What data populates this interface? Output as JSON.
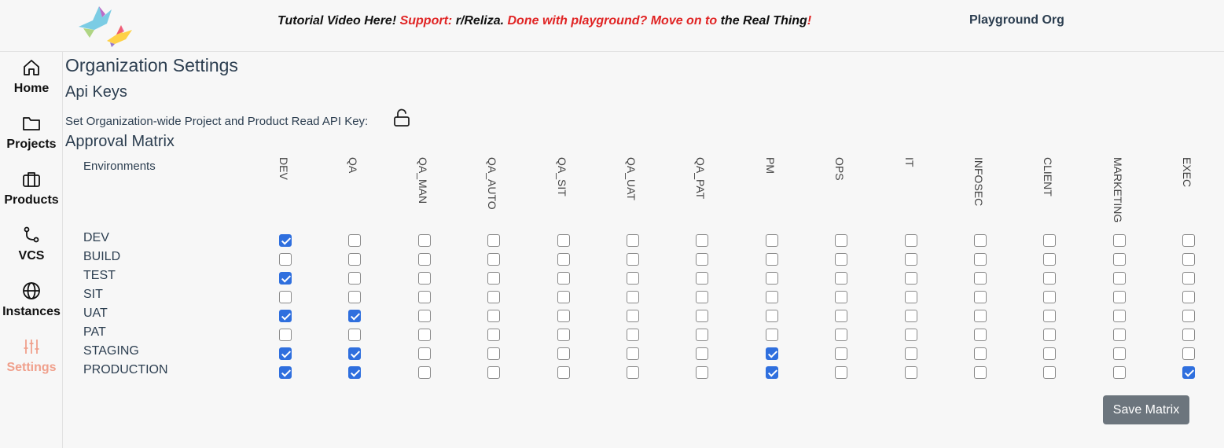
{
  "header": {
    "banner": [
      {
        "text": "Tutorial Video Here!",
        "style": "black"
      },
      {
        "text": " Support: ",
        "style": "red"
      },
      {
        "text": "r/Reliza",
        "style": "black"
      },
      {
        "text": ". ",
        "style": "black"
      },
      {
        "text": "Done with playground? Move on to",
        "style": "red"
      },
      {
        "text": " the Real Thing",
        "style": "black"
      },
      {
        "text": "!",
        "style": "red"
      }
    ],
    "org_name": "Playground Org",
    "logo_icon": "hummingbird-logo"
  },
  "sidebar": {
    "items": [
      {
        "label": "Home",
        "icon": "home-icon"
      },
      {
        "label": "Projects",
        "icon": "folder-icon"
      },
      {
        "label": "Products",
        "icon": "briefcase-icon"
      },
      {
        "label": "VCS",
        "icon": "git-branch-icon"
      },
      {
        "label": "Instances",
        "icon": "globe-icon"
      },
      {
        "label": "Settings",
        "icon": "sliders-icon",
        "active": true
      }
    ],
    "active_color": "#f0a08c"
  },
  "main": {
    "title": "Organization Settings",
    "api_keys_heading": "Api Keys",
    "api_key_text": "Set Organization-wide Project and Product Read API Key:",
    "approval_heading": "Approval Matrix",
    "environments_header": "Environments",
    "save_button": "Save Matrix"
  },
  "matrix": {
    "roles": [
      "DEV",
      "QA",
      "QA_MAN",
      "QA_AUTO",
      "QA_SIT",
      "QA_UAT",
      "QA_PAT",
      "PM",
      "OPS",
      "IT",
      "INFOSEC",
      "CLIENT",
      "MARKETING",
      "EXEC"
    ],
    "environments": [
      "DEV",
      "BUILD",
      "TEST",
      "SIT",
      "UAT",
      "PAT",
      "STAGING",
      "PRODUCTION"
    ],
    "checked": [
      [
        true,
        false,
        false,
        false,
        false,
        false,
        false,
        false,
        false,
        false,
        false,
        false,
        false,
        false
      ],
      [
        false,
        false,
        false,
        false,
        false,
        false,
        false,
        false,
        false,
        false,
        false,
        false,
        false,
        false
      ],
      [
        true,
        false,
        false,
        false,
        false,
        false,
        false,
        false,
        false,
        false,
        false,
        false,
        false,
        false
      ],
      [
        false,
        false,
        false,
        false,
        false,
        false,
        false,
        false,
        false,
        false,
        false,
        false,
        false,
        false
      ],
      [
        true,
        true,
        false,
        false,
        false,
        false,
        false,
        false,
        false,
        false,
        false,
        false,
        false,
        false
      ],
      [
        false,
        false,
        false,
        false,
        false,
        false,
        false,
        false,
        false,
        false,
        false,
        false,
        false,
        false
      ],
      [
        true,
        true,
        false,
        false,
        false,
        false,
        false,
        true,
        false,
        false,
        false,
        false,
        false,
        false
      ],
      [
        true,
        true,
        false,
        false,
        false,
        false,
        false,
        true,
        false,
        false,
        false,
        false,
        false,
        true
      ]
    ],
    "checked_color": "#2f6fde"
  }
}
